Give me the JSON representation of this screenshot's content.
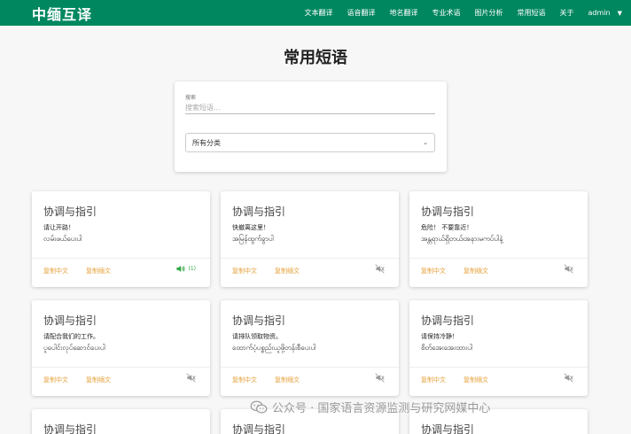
{
  "navbar": {
    "brand": "中缅互译",
    "items": [
      {
        "name": "nav-text-translate",
        "label": "文本翻译"
      },
      {
        "name": "nav-voice-translate",
        "label": "语音翻译"
      },
      {
        "name": "nav-place-translate",
        "label": "地名翻译"
      },
      {
        "name": "nav-terminology",
        "label": "专业术语"
      },
      {
        "name": "nav-image-analysis",
        "label": "图片分析"
      },
      {
        "name": "nav-common-phrases",
        "label": "常用短语"
      },
      {
        "name": "nav-about",
        "label": "关于"
      }
    ],
    "user": "admin"
  },
  "page": {
    "title": "常用短语"
  },
  "filter": {
    "search_label": "搜索",
    "search_placeholder": "搜索短语...",
    "category_selected": "所有分类"
  },
  "cards": [
    {
      "title": "协调与指引",
      "zh": "请让开路！",
      "my": "လမ်းဖယ်ပေးပါ",
      "copy_zh": "复制中文",
      "copy_my": "复制缅文",
      "audio": "on",
      "count": "(1)"
    },
    {
      "title": "协调与指引",
      "zh": "快撤离这里！",
      "my": "အမြန်ထွက်ခွာပါ",
      "copy_zh": "复制中文",
      "copy_my": "复制缅文",
      "audio": "off"
    },
    {
      "title": "协调与指引",
      "zh": "危险！ 不要靠近！",
      "my": "အန္တရာယ်ရှိတယ်၊အနားမကပ်ပါနဲ့",
      "copy_zh": "复制中文",
      "copy_my": "复制缅文",
      "audio": "off"
    },
    {
      "title": "协调与指引",
      "zh": "请配合我们的工作。",
      "my": "ပူပေါင်းလုပ်ဆောင်ပေးပါ",
      "copy_zh": "复制中文",
      "copy_my": "复制缅文",
      "audio": "off"
    },
    {
      "title": "协调与指引",
      "zh": "请排队领取物资。",
      "my": "ထောက်ပံ့ပစ္စည်းယူဖို့တန်းစီပေးပါ",
      "copy_zh": "复制中文",
      "copy_my": "复制缅文",
      "audio": "off"
    },
    {
      "title": "协调与指引",
      "zh": "请保持冷静！",
      "my": "စိတ်အေးအေးထားပါ",
      "copy_zh": "复制中文",
      "copy_my": "复制缅文",
      "audio": "off"
    },
    {
      "title": "协调与指引"
    },
    {
      "title": "协调与指引"
    },
    {
      "title": "协调与指引"
    }
  ],
  "icons": {
    "audio_on": "volume-up-icon",
    "audio_off": "volume-mute-icon"
  },
  "colors": {
    "primary": "#00875f",
    "copy_link": "#e6a23c",
    "audio_active": "#2aa63c"
  },
  "watermark": "公众号 · 国家语言资源监测与研究网媒中心"
}
